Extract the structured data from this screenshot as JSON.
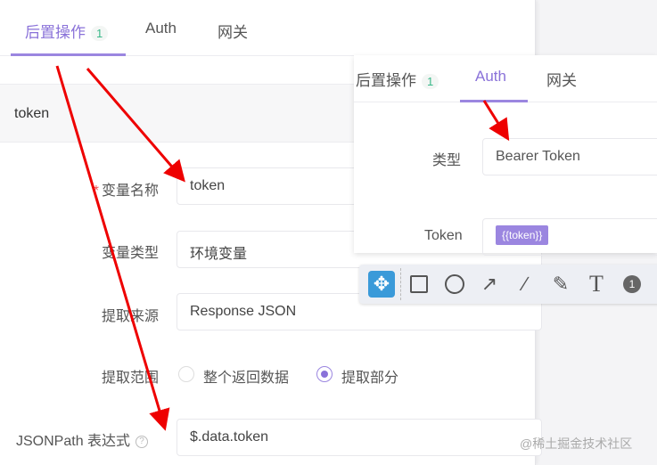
{
  "main": {
    "tabs": [
      {
        "label": "后置操作",
        "badge": "1"
      },
      {
        "label": "Auth"
      },
      {
        "label": "网关"
      }
    ],
    "list_item": "token",
    "form": {
      "var_name_label": "变量名称",
      "var_name_value": "token",
      "var_type_label": "变量类型",
      "var_type_value": "环境变量",
      "source_label": "提取来源",
      "source_value": "Response JSON",
      "scope_label": "提取范围",
      "scope_options": [
        "整个返回数据",
        "提取部分"
      ],
      "scope_selected": "提取部分",
      "jsonpath_label": "JSONPath 表达式",
      "jsonpath_value": "$.data.token"
    }
  },
  "overlay": {
    "tabs": [
      {
        "label": "后置操作",
        "badge": "1"
      },
      {
        "label": "Auth"
      },
      {
        "label": "网关"
      }
    ],
    "type_label": "类型",
    "type_value": "Bearer Token",
    "token_label": "Token",
    "token_value": "{{token}}"
  },
  "toolbar": {
    "tools": [
      "move-icon",
      "rectangle-icon",
      "circle-icon",
      "arrow-icon",
      "line-icon",
      "pen-icon",
      "text-icon",
      "number-icon"
    ],
    "text_glyph": "T",
    "number_glyph": "1"
  },
  "watermark": "@稀土掘金技术社区",
  "colors": {
    "accent": "#8a72d9",
    "arrow": "#ee0000"
  }
}
